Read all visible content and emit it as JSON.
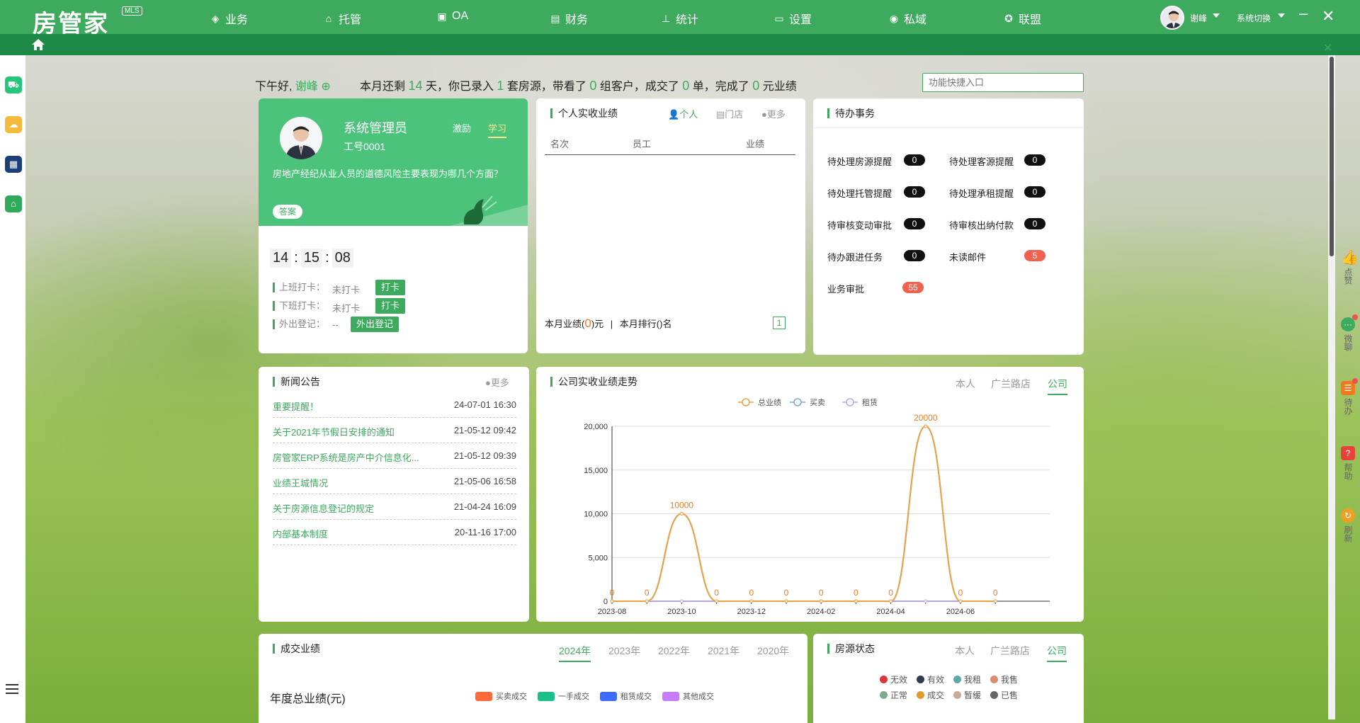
{
  "top_nav": {
    "logo": "房管家",
    "logo_badge": "MLS",
    "items": [
      {
        "label": "业务",
        "icon": "layers-icon"
      },
      {
        "label": "托管",
        "icon": "hand-house-icon"
      },
      {
        "label": "OA",
        "icon": "briefcase-icon"
      },
      {
        "label": "财务",
        "icon": "wallet-icon"
      },
      {
        "label": "统计",
        "icon": "org-chart-icon"
      },
      {
        "label": "设置",
        "icon": "monitor-icon"
      },
      {
        "label": "私域",
        "icon": "chat-icon"
      },
      {
        "label": "联盟",
        "icon": "star-badge-icon"
      }
    ],
    "user_name": "谢峰",
    "system_switch": "系统切换"
  },
  "greeting": {
    "prefix": "下午好,",
    "name": "谢峰",
    "s1": "本月还剩",
    "days_left": "14",
    "s2": "天，你已录入",
    "houses": "1",
    "s3": "套房源，带看了",
    "visits": "0",
    "s4": "组客户，成交了",
    "deals": "0",
    "s5": "单，完成了",
    "amount": "0",
    "s6": "元业绩"
  },
  "quick_entry": {
    "placeholder": "功能快捷入口"
  },
  "profile": {
    "name": "系统管理员",
    "employee_id": "工号0001",
    "tab_incentive": "激励",
    "tab_study": "学习",
    "question": "房地产经纪从业人员的道德风险主要表现为哪几个方面？",
    "answer_button": "答案",
    "clock": {
      "h": "14",
      "m": "15",
      "s": "08"
    },
    "on_duty_label": "上班打卡：",
    "on_duty_value": "未打卡",
    "off_duty_label": "下班打卡：",
    "off_duty_value": "未打卡",
    "punch_button": "打卡",
    "outing_label": "外出登记：",
    "outing_value": "--",
    "outing_button": "外出登记"
  },
  "personal_perf": {
    "title": "个人实收业绩",
    "tab_personal": "个人",
    "tab_store": "门店",
    "more": "更多",
    "col_rank": "名次",
    "col_staff": "员工",
    "col_perf": "业绩",
    "foot_1": "本月业绩(",
    "foot_value": "0",
    "foot_2": ")元",
    "foot_sep": "|",
    "foot_rank": "本月排行()名",
    "page": "1"
  },
  "todo": {
    "title": "待办事务",
    "items": [
      {
        "label": "待处理房源提醒",
        "count": "0"
      },
      {
        "label": "待处理客源提醒",
        "count": "0"
      },
      {
        "label": "待处理托管提醒",
        "count": "0"
      },
      {
        "label": "待处理承租提醒",
        "count": "0"
      },
      {
        "label": "待审核变动审批",
        "count": "0"
      },
      {
        "label": "待审核出纳付款",
        "count": "0"
      },
      {
        "label": "待办跟进任务",
        "count": "0"
      },
      {
        "label": "未读邮件",
        "count": "5"
      },
      {
        "label": "业务审批",
        "count": "55"
      }
    ]
  },
  "news": {
    "title": "新闻公告",
    "more": "更多",
    "items": [
      {
        "title": "重要提醒！",
        "date": "24-07-01 16:30"
      },
      {
        "title": "关于2021年节假日安排的通知",
        "date": "21-05-12 09:42"
      },
      {
        "title": "房管家ERP系统是房产中介信息化...",
        "date": "21-05-12 09:39"
      },
      {
        "title": "业绩王城情况",
        "date": "21-05-06 16:58"
      },
      {
        "title": "关于房源信息登记的规定",
        "date": "21-04-24 16:09"
      },
      {
        "title": "内部基本制度",
        "date": "20-11-16 17:00"
      }
    ]
  },
  "trend": {
    "title": "公司实收业绩走势",
    "tab_self": "本人",
    "tab_store": "广兰路店",
    "tab_company": "公司"
  },
  "chart_data": {
    "type": "line",
    "x": [
      "2023-08",
      "2023-09",
      "2023-10",
      "2023-11",
      "2023-12",
      "2024-01",
      "2024-02",
      "2024-03",
      "2024-04",
      "2024-05",
      "2024-06",
      "2024-07"
    ],
    "x_tick_labels": [
      "2023-08",
      "2023-10",
      "2023-12",
      "2024-02",
      "2024-04",
      "2024-06"
    ],
    "series": [
      {
        "name": "总业绩",
        "color": "#f0a040",
        "values": [
          0,
          0,
          10000,
          0,
          0,
          0,
          0,
          0,
          0,
          20000,
          0,
          0
        ]
      },
      {
        "name": "买卖",
        "color": "#7ba9d1",
        "values": [
          0,
          0,
          10000,
          0,
          0,
          0,
          0,
          0,
          0,
          20000,
          0,
          0
        ]
      },
      {
        "name": "租赁",
        "color": "#b9a6e0",
        "values": [
          0,
          0,
          0,
          0,
          0,
          0,
          0,
          0,
          0,
          0,
          0,
          0
        ]
      }
    ],
    "data_labels": [
      "0",
      "0",
      "10000",
      "0",
      "0",
      "0",
      "0",
      "0",
      "0",
      "20000",
      "0",
      "0"
    ],
    "y_ticks": [
      "0",
      "5,000",
      "10,000",
      "15,000",
      "20,000"
    ],
    "ylim": [
      0,
      20000
    ],
    "grid": true,
    "legend": "top-center"
  },
  "deals": {
    "title": "成交业绩",
    "years": [
      "2024年",
      "2023年",
      "2022年",
      "2021年",
      "2020年"
    ],
    "year_total": "年度总业绩(元)",
    "legend": [
      {
        "label": "买卖成交",
        "color": "#ff6a3d"
      },
      {
        "label": "一手成交",
        "color": "#1bbf8a"
      },
      {
        "label": "租赁成交",
        "color": "#3d6bff"
      },
      {
        "label": "其他成交",
        "color": "#c77dff"
      }
    ]
  },
  "house_status": {
    "title": "房源状态",
    "tab_self": "本人",
    "tab_store": "广兰路店",
    "tab_company": "公司",
    "legend": [
      {
        "label": "无效",
        "color": "#d9383e"
      },
      {
        "label": "有效",
        "color": "#2d3e50"
      },
      {
        "label": "我租",
        "color": "#5fa8a8"
      },
      {
        "label": "我售",
        "color": "#d98b6a"
      },
      {
        "label": "正常",
        "color": "#7fa98b"
      },
      {
        "label": "成交",
        "color": "#e09a2d"
      },
      {
        "label": "暂缓",
        "color": "#c9a99a"
      },
      {
        "label": "已售",
        "color": "#666666"
      }
    ]
  },
  "right_sidebar": [
    {
      "label": "点赞",
      "icon": "thumbs-up-icon",
      "color": "#f0a020"
    },
    {
      "label": "微聊",
      "icon": "chat-bubble-icon",
      "color": "#3daa5d"
    },
    {
      "label": "待办",
      "icon": "todo-icon",
      "color": "#f07b1f"
    },
    {
      "label": "帮助",
      "icon": "help-icon",
      "color": "#e8423a"
    },
    {
      "label": "刷新",
      "icon": "refresh-icon",
      "color": "#f0a020"
    }
  ]
}
